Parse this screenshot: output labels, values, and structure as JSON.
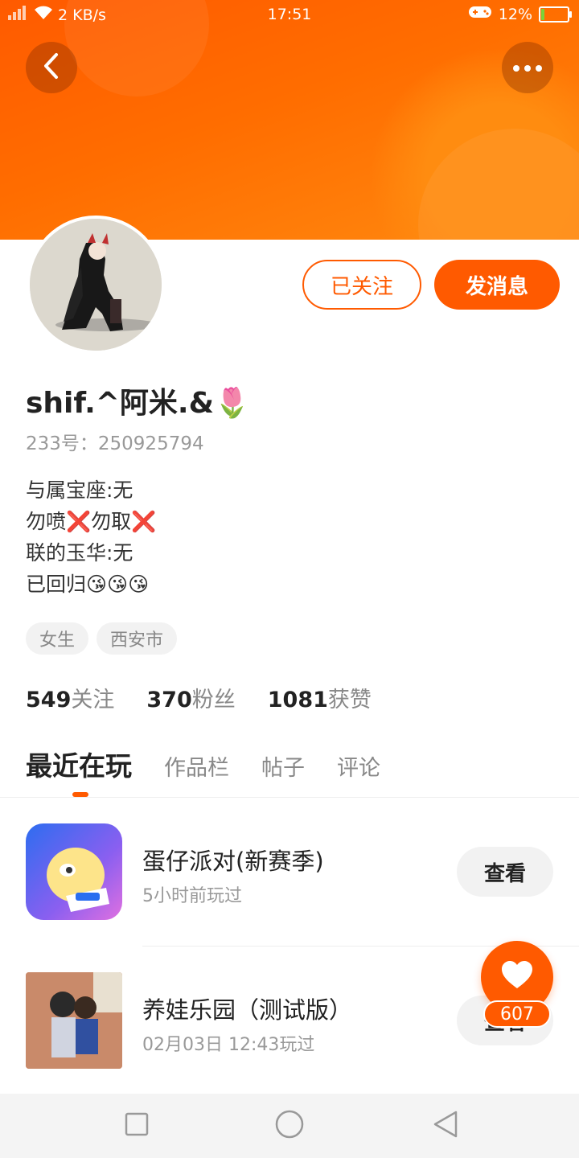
{
  "status_bar": {
    "network_speed": "2 KB/s",
    "time": "17:51",
    "battery_percent": "12%",
    "battery_level": 0.12
  },
  "header": {
    "back_icon": "chevron-left-icon",
    "more_icon": "more-dots-icon"
  },
  "profile": {
    "follow_label": "已关注",
    "message_label": "发消息",
    "username": "shif.^阿米.&🌷",
    "id_text": "233号：250925794",
    "bio_lines": [
      "与属宝座:无",
      "勿喷❌勿取❌",
      "联的玉华:无",
      "已回归😘😘😘"
    ],
    "tags": [
      "女生",
      "西安市"
    ],
    "stats": [
      {
        "value": "549",
        "label": "关注"
      },
      {
        "value": "370",
        "label": "粉丝"
      },
      {
        "value": "1081",
        "label": "获赞"
      }
    ]
  },
  "tabs": [
    {
      "label": "最近在玩",
      "active": true
    },
    {
      "label": "作品栏",
      "active": false
    },
    {
      "label": "帖子",
      "active": false
    },
    {
      "label": "评论",
      "active": false
    }
  ],
  "recent_games": [
    {
      "name": "蛋仔派对(新赛季)",
      "time": "5小时前玩过",
      "action": "查看"
    },
    {
      "name": "养娃乐园（测试版）",
      "time": "02月03日 12:43玩过",
      "action": "查看"
    }
  ],
  "like_fab": {
    "count": "607",
    "icon": "heart-icon"
  },
  "nav_bar": {
    "buttons": [
      "recent-apps",
      "home",
      "back"
    ]
  },
  "colors": {
    "accent": "#ff5a00",
    "header_gradient_end": "#ff8a10"
  }
}
